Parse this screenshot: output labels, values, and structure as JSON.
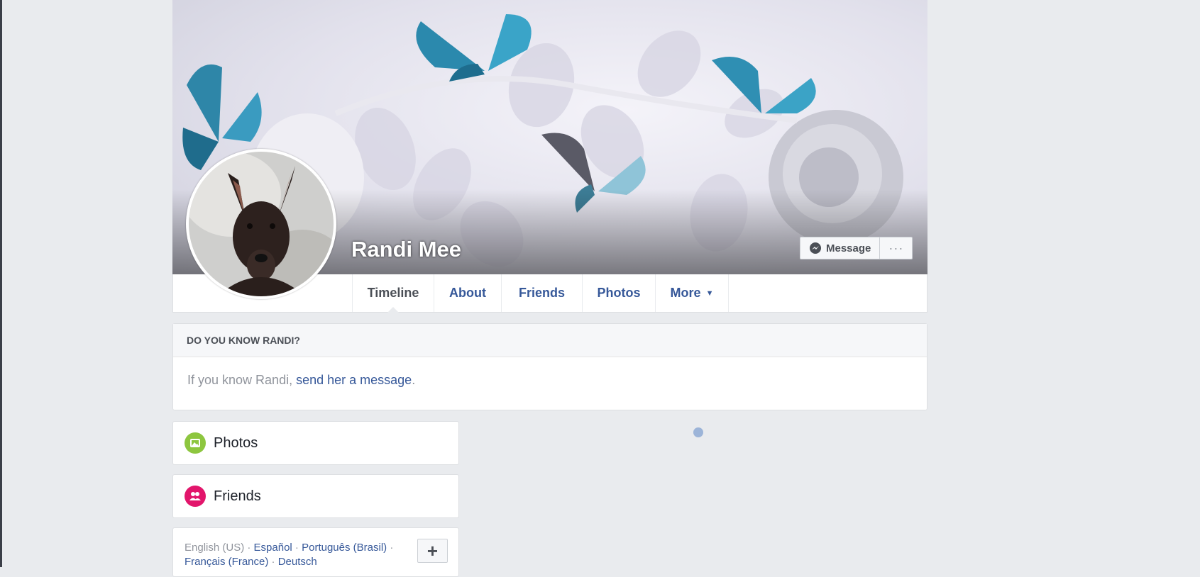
{
  "profile": {
    "name": "Randi Mee"
  },
  "cover_actions": {
    "message_label": "Message",
    "more_label": "···"
  },
  "tabs": [
    {
      "label": "Timeline"
    },
    {
      "label": "About"
    },
    {
      "label": "Friends"
    },
    {
      "label": "Photos"
    },
    {
      "label": "More",
      "caret": "▼"
    }
  ],
  "know_card": {
    "heading": "DO YOU KNOW RANDI?",
    "text_before": "If you know Randi, ",
    "link": "send her a message",
    "text_after": "."
  },
  "side_cards": {
    "photos_label": "Photos",
    "friends_label": "Friends"
  },
  "languages": {
    "current": "English (US)",
    "sep": " · ",
    "others": [
      "Español",
      "Português (Brasil)",
      "Français (France)",
      "Deutsch"
    ],
    "add_label": "+"
  },
  "colors": {
    "link": "#365899",
    "photos_icon_bg": "#8dc63f",
    "friends_icon_bg": "#e2156b"
  }
}
